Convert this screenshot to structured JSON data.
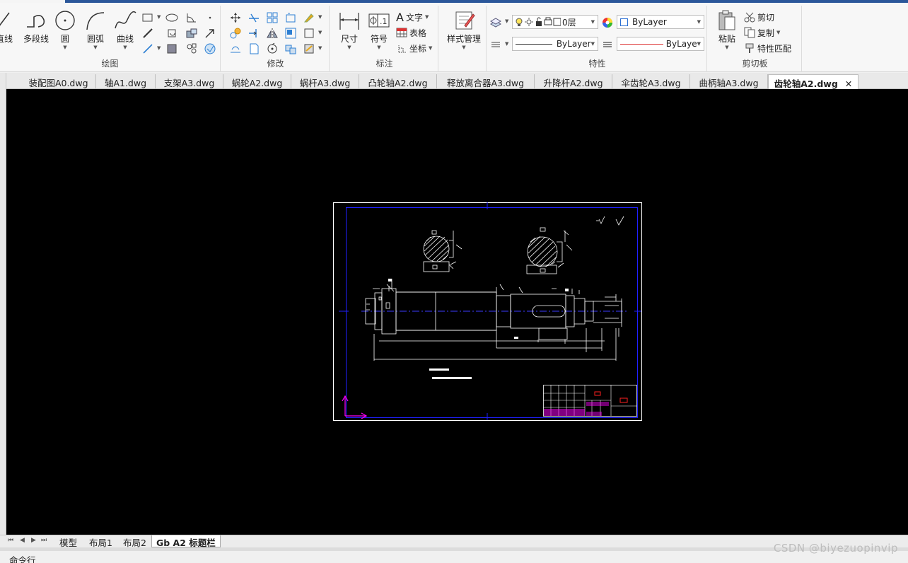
{
  "ribbon": {
    "draw_panel": {
      "title": "绘图",
      "line": "直线",
      "polyline": "多段线",
      "circle": "圆",
      "arc": "圆弧",
      "curve": "曲线"
    },
    "modify_panel": {
      "title": "修改"
    },
    "annotation_panel": {
      "title": "标注",
      "dimension": "尺寸",
      "symbol": "符号",
      "text": "文字",
      "table": "表格",
      "coordinate": "坐标"
    },
    "style_panel": {
      "style_manager": "样式管理"
    },
    "properties_panel": {
      "title": "特性",
      "layer_value": "0层",
      "color_value": "ByLayer",
      "linetype_value": "ByLayer",
      "lineweight_value": "ByLaye"
    },
    "clipboard_panel": {
      "title": "剪切板",
      "paste": "粘贴",
      "cut": "剪切",
      "copy": "复制",
      "match_properties": "特性匹配"
    }
  },
  "file_tabs": [
    {
      "label": "装配图A0.dwg"
    },
    {
      "label": "轴A1.dwg"
    },
    {
      "label": "支架A3.dwg"
    },
    {
      "label": "蜗轮A2.dwg"
    },
    {
      "label": "蜗杆A3.dwg"
    },
    {
      "label": "凸轮轴A2.dwg"
    },
    {
      "label": "释放离合器A3.dwg"
    },
    {
      "label": "升降杆A2.dwg"
    },
    {
      "label": "伞齿轮A3.dwg"
    },
    {
      "label": "曲柄轴A3.dwg"
    },
    {
      "label": "齿轮轴A2.dwg",
      "active": true
    }
  ],
  "layout_tabs": [
    {
      "label": "模型"
    },
    {
      "label": "布局1"
    },
    {
      "label": "布局2"
    },
    {
      "label": "Gb A2 标题栏",
      "active": true
    }
  ],
  "command_line": {
    "label": "命令行"
  },
  "watermark": "CSDN @biyezuopinvip",
  "colors": {
    "accent": "#2b579a",
    "canvas": "#000000",
    "frame_blue": "#2020ff",
    "ucs_magenta": "#ff00ff",
    "title_block_red": "#ff2020"
  }
}
